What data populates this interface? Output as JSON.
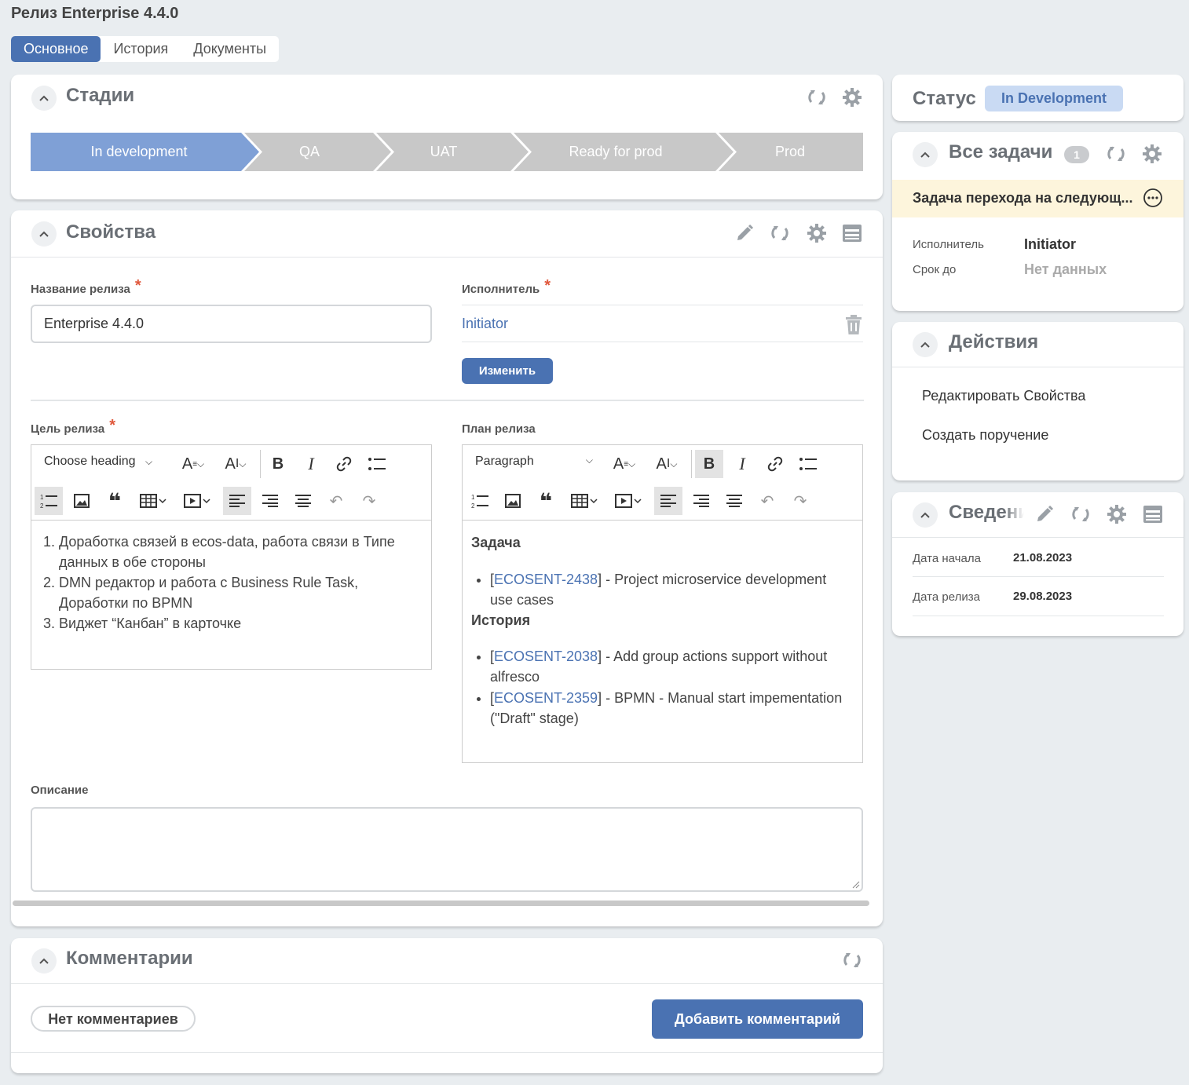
{
  "page": {
    "title": "Релиз Enterprise 4.4.0"
  },
  "tabs": [
    "Основное",
    "История",
    "Документы"
  ],
  "stages_panel": {
    "title": "Стадии",
    "stages": [
      "In development",
      "QA",
      "UAT",
      "Ready for prod",
      "Prod"
    ],
    "active_stage": "In development"
  },
  "props": {
    "title": "Свойства",
    "release_name_label": "Название релиза",
    "release_name_value": "Enterprise 4.4.0",
    "assignee_label": "Исполнитель",
    "assignee_value": "Initiator",
    "change_button": "Изменить",
    "goal_label": "Цель релиза",
    "goal_editor": {
      "heading_select": "Choose heading",
      "items": [
        "Доработка связей в ecos-data, работа связи в Типе данных в обе стороны",
        "DMN редактор и работа с Business Rule Task, Доработки по BPMN",
        "Виджет “Канбан” в карточке"
      ]
    },
    "plan_label": "План релиза",
    "plan_editor": {
      "heading_select": "Paragraph",
      "section1_title": "Задача",
      "section1_items": [
        {
          "key": "ECOSENT-2438",
          "text": " - Project microservice development use cases"
        }
      ],
      "section2_title": "История",
      "section2_items": [
        {
          "key": "ECOSENT-2038",
          "text": " - Add group actions support without alfresco"
        },
        {
          "key": "ECOSENT-2359",
          "text": " - BPMN - Manual start impementation (\"Draft\" stage)"
        }
      ]
    },
    "description_label": "Описание",
    "description_value": ""
  },
  "comments": {
    "title": "Комментарии",
    "empty_label": "Нет комментариев",
    "add_button": "Добавить комментарий"
  },
  "status": {
    "label": "Статус",
    "value": "In Development"
  },
  "tasks": {
    "title": "Все задачи",
    "count": "1",
    "task_title": "Задача перехода на следующ...",
    "assignee_label": "Исполнитель",
    "assignee_value": "Initiator",
    "due_label": "Срок до",
    "due_value": "Нет данных"
  },
  "actions": {
    "title": "Действия",
    "items": [
      "Редактировать Свойства",
      "Создать поручение"
    ]
  },
  "info": {
    "title": "Сведения",
    "start_label": "Дата начала",
    "start_value": "21.08.2023",
    "release_label": "Дата релиза",
    "release_value": "29.08.2023"
  },
  "colors": {
    "accent": "#4a72b2",
    "stage_active": "#7fa0d6",
    "stage_inactive": "#c8c8c8",
    "task_highlight": "#fdf5dc",
    "required": "#e0583c"
  }
}
